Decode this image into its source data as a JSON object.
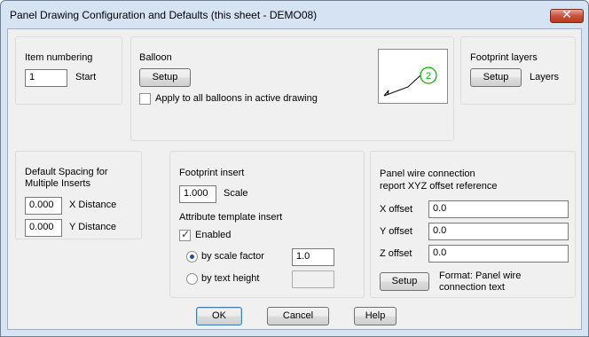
{
  "window": {
    "title": "Panel Drawing Configuration and Defaults (this sheet - DEMO08)",
    "close_glyph": "✕"
  },
  "item_numbering": {
    "heading": "Item numbering",
    "value": "1",
    "label": "Start"
  },
  "balloon": {
    "heading": "Balloon",
    "setup_label": "Setup",
    "apply_all_label": "Apply to all balloons in active drawing",
    "apply_all_checked": false,
    "preview_number": "2"
  },
  "footprint_layers": {
    "heading": "Footprint layers",
    "setup_label": "Setup",
    "label": "Layers"
  },
  "default_spacing": {
    "heading_line1": "Default Spacing for",
    "heading_line2": "Multiple Inserts",
    "x_value": "0.000",
    "x_label": "X Distance",
    "y_value": "0.000",
    "y_label": "Y Distance"
  },
  "footprint_insert": {
    "heading": "Footprint insert",
    "scale_value": "1.000",
    "scale_label": "Scale",
    "attr_heading": "Attribute template insert",
    "enabled_label": "Enabled",
    "enabled_checked": true,
    "by_scale_label": "by scale factor",
    "by_scale_value": "1.0",
    "by_scale_selected": true,
    "by_text_label": "by text height",
    "by_text_value": ""
  },
  "panel_wire": {
    "heading_line1": "Panel wire connection",
    "heading_line2": "report XYZ offset reference",
    "x_label": "X offset",
    "x_value": "0.0",
    "y_label": "Y offset",
    "y_value": "0.0",
    "z_label": "Z offset",
    "z_value": "0.0",
    "setup_label": "Setup",
    "format_line1": "Format: Panel wire",
    "format_line2": "connection text"
  },
  "buttons": {
    "ok": "OK",
    "cancel": "Cancel",
    "help": "Help"
  },
  "colors": {
    "balloon_circle": "#00aa00",
    "balloon_leader": "#000000",
    "radio_dot": "#1c4ea0"
  }
}
